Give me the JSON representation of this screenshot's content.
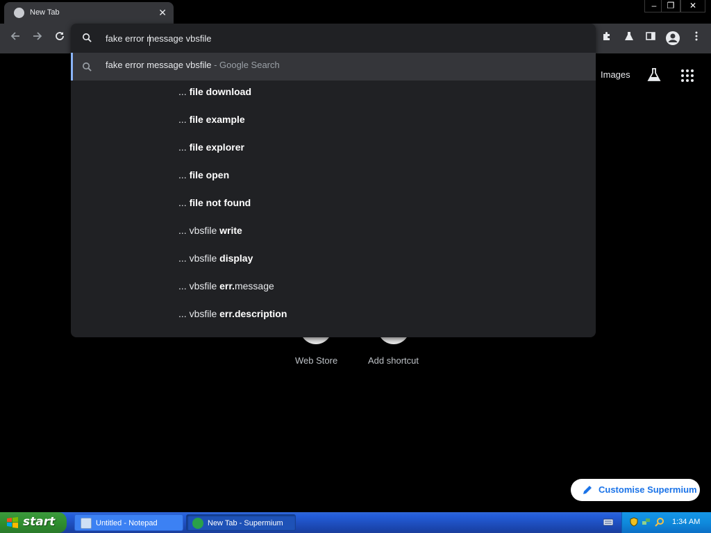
{
  "browser": {
    "tab_title": "New Tab",
    "tab_close": "✕",
    "window_controls": {
      "minimize": "–",
      "restore": "❐",
      "close": "✕"
    }
  },
  "omnibox": {
    "query": "fake error message vbsfile",
    "top_suggestion": {
      "text": "fake error message vbsfile",
      "suffix": " - Google Search"
    },
    "suggestions": [
      {
        "prefix": "... ",
        "plain": "",
        "bold": "file download",
        "rest": ""
      },
      {
        "prefix": "... ",
        "plain": "",
        "bold": "file example",
        "rest": ""
      },
      {
        "prefix": "... ",
        "plain": "",
        "bold": "file explorer",
        "rest": ""
      },
      {
        "prefix": "... ",
        "plain": "",
        "bold": "file open",
        "rest": ""
      },
      {
        "prefix": "... ",
        "plain": "",
        "bold": "file not found",
        "rest": ""
      },
      {
        "prefix": "... ",
        "plain": "vbsfile ",
        "bold": "write",
        "rest": ""
      },
      {
        "prefix": "... ",
        "plain": "vbsfile ",
        "bold": "display",
        "rest": ""
      },
      {
        "prefix": "... ",
        "plain": "vbsfile ",
        "bold": "err.",
        "rest": "message"
      },
      {
        "prefix": "... ",
        "plain": "vbsfile ",
        "bold": "err.description",
        "rest": ""
      }
    ]
  },
  "page": {
    "images_link": "Images",
    "shortcuts": [
      {
        "label": "Web Store"
      },
      {
        "label": "Add shortcut"
      }
    ],
    "customise_label": "Customise Supermium"
  },
  "taskbar": {
    "start_label": "start",
    "buttons": [
      {
        "label": "Untitled - Notepad",
        "active": false
      },
      {
        "label": "New Tab - Supermium",
        "active": true
      }
    ],
    "clock": "1:34 AM"
  },
  "colors": {
    "accent": "#8ab4f8",
    "omnibox_bg": "#202124",
    "toolbar_bg": "#35363a",
    "customise_text": "#1a73e8"
  }
}
